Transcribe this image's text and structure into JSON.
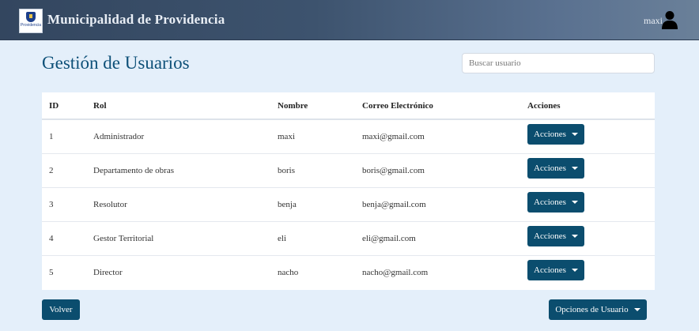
{
  "header": {
    "logo_text": "Providencia",
    "title": "Municipalidad de Providencia",
    "user_name": "maxi",
    "user_icon": "user-icon"
  },
  "page": {
    "title": "Gestión de Usuarios",
    "search_placeholder": "Buscar usuario"
  },
  "table": {
    "columns": [
      "ID",
      "Rol",
      "Nombre",
      "Correo Electrónico",
      "Acciones"
    ],
    "rows": [
      {
        "id": "1",
        "rol": "Administrador",
        "nombre": "maxi",
        "correo": "maxi@gmail.com",
        "action": "Acciones"
      },
      {
        "id": "2",
        "rol": "Departamento de obras",
        "nombre": "boris",
        "correo": "boris@gmail.com",
        "action": "Acciones"
      },
      {
        "id": "3",
        "rol": "Resolutor",
        "nombre": "benja",
        "correo": "benja@gmail.com",
        "action": "Acciones"
      },
      {
        "id": "4",
        "rol": "Gestor Territorial",
        "nombre": "eli",
        "correo": "eli@gmail.com",
        "action": "Acciones"
      },
      {
        "id": "5",
        "rol": "Director",
        "nombre": "nacho",
        "correo": "nacho@gmail.com",
        "action": "Acciones"
      }
    ]
  },
  "footer": {
    "back_label": "Volver",
    "options_label": "Opciones de Usuario"
  },
  "colors": {
    "primary": "#0b4d6e",
    "title": "#0d5078",
    "background": "#e4effa",
    "topbar": "#3d536e"
  }
}
